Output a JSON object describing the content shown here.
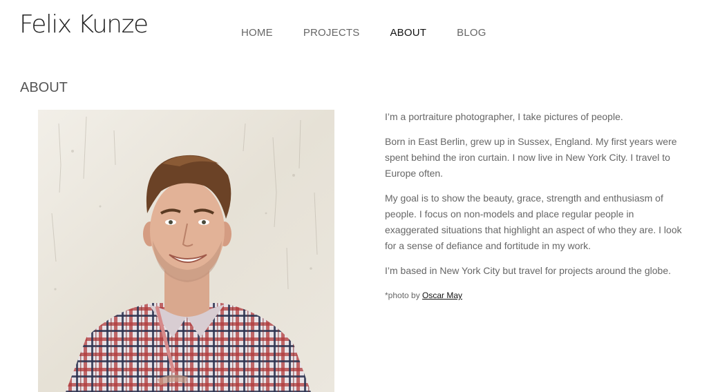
{
  "site": {
    "logo_text": "Felix Kunze"
  },
  "nav": {
    "items": [
      {
        "label": "HOME"
      },
      {
        "label": "PROJECTS"
      },
      {
        "label": "ABOUT"
      },
      {
        "label": "BLOG"
      }
    ],
    "active": "ABOUT"
  },
  "page": {
    "title": "ABOUT"
  },
  "bio": {
    "paragraphs": [
      "I’m a portraiture photographer, I take pictures of people.",
      "Born in East Berlin, grew up in Sussex, England. My first years were spent behind the iron curtain. I now live in New York City. I travel to Europe often.",
      "My goal is to show the beauty, grace, strength and enthusiasm of people. I focus on non-models and place regular people in exaggerated situations that highlight an aspect of who they are. I look for a sense of defiance and fortitude in my work.",
      "I’m based in New York City but travel for projects around the globe."
    ],
    "credit_prefix": "*photo by ",
    "credit_link": "Oscar May"
  },
  "colors": {
    "text": "#666666",
    "active_nav": "#111111",
    "wall": "#e9e5dc",
    "shirt_red": "#b03a3a",
    "shirt_navy": "#2b3350"
  },
  "icons": {
    "photo": "portrait-photo"
  }
}
